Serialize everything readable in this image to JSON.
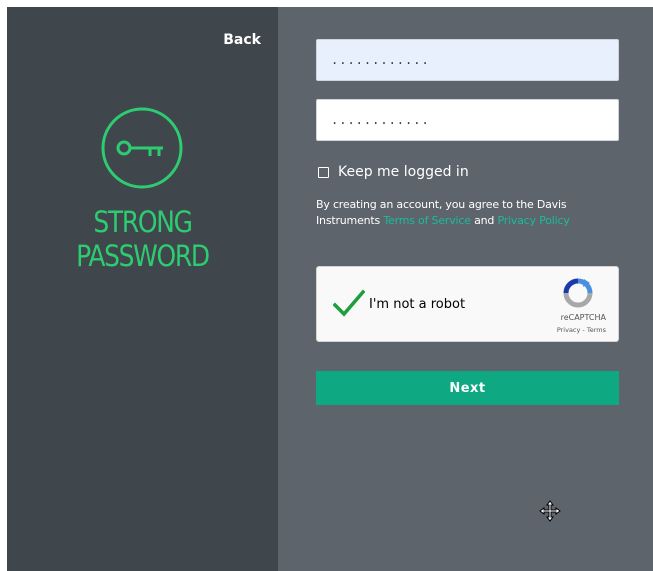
{
  "left_panel": {
    "back_label": "Back",
    "icon": "key-icon",
    "title": "STRONG PASSWORD"
  },
  "form": {
    "password_value": "............",
    "confirm_password_value": "............",
    "keep_logged_in_label": "Keep me logged in",
    "keep_logged_in_checked": false,
    "terms_prefix": "By creating an account, you agree to the Davis Instruments ",
    "terms_of_service_link": "Terms of Service",
    "terms_and": " and ",
    "privacy_policy_link": "Privacy Policy",
    "next_label": "Next"
  },
  "captcha": {
    "label": "I'm not a robot",
    "checked": true,
    "brand": "reCAPTCHA",
    "privacy_link": "Privacy",
    "separator": " - ",
    "terms_link": "Terms"
  },
  "colors": {
    "left_bg": "#3f474d",
    "right_bg": "#5d646b",
    "accent_green": "#2ecc71",
    "button_green": "#0ea982",
    "link_color": "#1abc9c",
    "autofill_bg": "#e8f0fe"
  }
}
